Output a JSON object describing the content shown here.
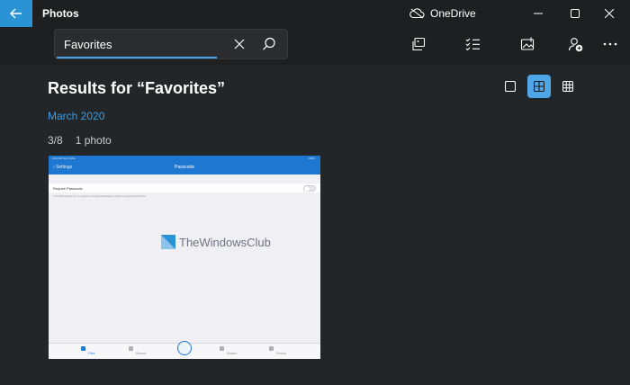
{
  "window": {
    "title": "Photos",
    "cloud_label": "OneDrive",
    "controls": [
      "minimize",
      "maximize",
      "close"
    ]
  },
  "search": {
    "value": "Favorites",
    "clear_icon": "close-icon",
    "submit_icon": "search-icon"
  },
  "toolbar": {
    "buttons": [
      "import-photos-icon",
      "select-icon",
      "add-to-album-icon",
      "add-people-icon",
      "more-icon"
    ]
  },
  "results": {
    "heading": "Results for “Favorites”",
    "group_label": "March 2020",
    "position": "3/8",
    "count": "1 photo"
  },
  "view_options": {
    "selected": "medium",
    "options": [
      "large",
      "medium",
      "small"
    ]
  },
  "thumbnail": {
    "status_left": "9:41 AM  Sun 8 Mar",
    "status_right": "100%",
    "nav_back": "Settings",
    "nav_title": "Passcode",
    "row_label": "Require Passcode",
    "description": "Turn this feature on to require a 4-digit passcode in order to access OneDrive.",
    "tabs": [
      "Files",
      "Recent",
      "Shared",
      "Photos"
    ],
    "active_tab": "Files",
    "watermark": "TheWindowsClub"
  },
  "colors": {
    "accent": "#2a93d6",
    "link": "#3d9ae0",
    "background": "#232629",
    "header": "#1e1f21"
  }
}
